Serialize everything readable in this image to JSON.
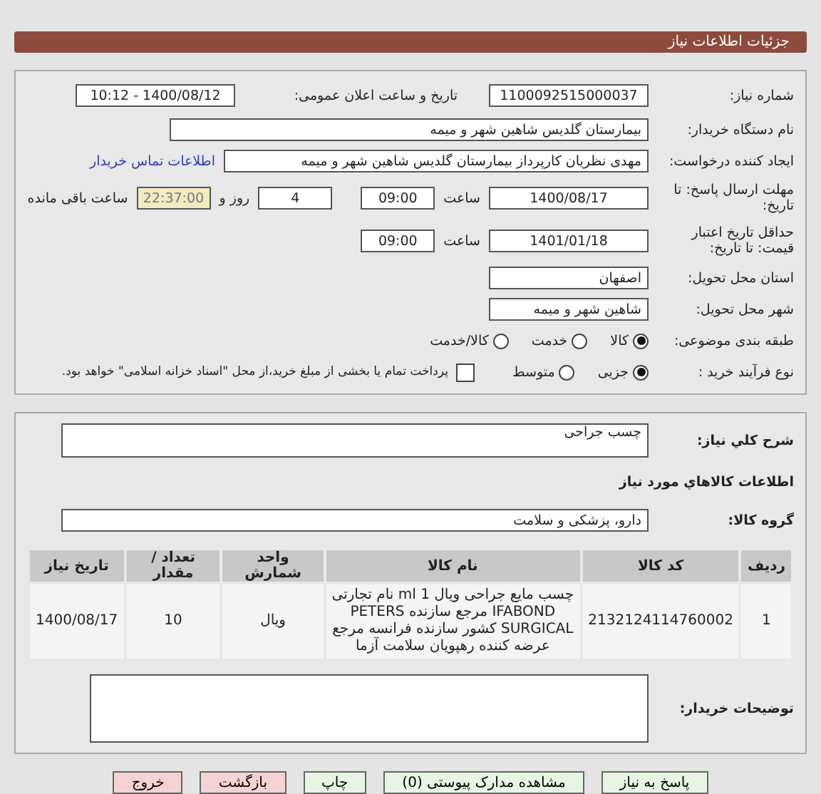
{
  "header": {
    "title": "جزئیات اطلاعات نیاز"
  },
  "details": {
    "need_number": {
      "label": "شماره نیاز:",
      "value": "1100092515000037"
    },
    "announce": {
      "label": "تاریخ و ساعت اعلان عمومی:",
      "value": "1400/08/12 - 10:12"
    },
    "buyer": {
      "label": "نام دستگاه خریدار:",
      "value": "بیمارستان گلدیس  شاهین شهر و میمه"
    },
    "creator": {
      "label": "ایجاد کننده درخواست:",
      "value": "مهدی نظریان کارپرداز بیمارستان گلدیس  شاهین شهر و میمه",
      "link": "اطلاعات تماس خریدار"
    },
    "deadline": {
      "label": "مهلت ارسال پاسخ: تا تاریخ:",
      "date": "1400/08/17",
      "time_label": "ساعت",
      "time": "09:00",
      "days": "4",
      "days_label": "روز و",
      "remaining": "22:37:00",
      "remaining_label": "ساعت باقی مانده"
    },
    "validity": {
      "label": "حداقل تاریخ اعتبار قیمت: تا تاریخ:",
      "date": "1401/01/18",
      "time_label": "ساعت",
      "time": "09:00"
    },
    "province": {
      "label": "استان محل تحویل:",
      "value": "اصفهان"
    },
    "city": {
      "label": "شهر محل تحویل:",
      "value": "شاهین شهر و میمه"
    },
    "category": {
      "label": "طبقه بندی موضوعی:",
      "options": [
        {
          "label": "کالا",
          "selected": true
        },
        {
          "label": "خدمت",
          "selected": false
        },
        {
          "label": "کالا/خدمت",
          "selected": false
        }
      ]
    },
    "process": {
      "label": "نوع فرآیند خرید :",
      "options": [
        {
          "label": "جزیی",
          "selected": true
        },
        {
          "label": "متوسط",
          "selected": false
        }
      ],
      "treasury": {
        "checked": false,
        "text": "پرداخت تمام یا بخشی از مبلغ خرید،از محل \"اسناد خزانه اسلامی\" خواهد بود."
      }
    }
  },
  "goods": {
    "summary": {
      "label": "شرح کلي نياز:",
      "value": "چسب جراحی"
    },
    "heading": "اطلاعات کالاهاي مورد نياز",
    "group": {
      "label": "گروه کالا:",
      "value": "دارو، پزشکی و سلامت"
    },
    "table": {
      "columns": [
        "ردیف",
        "کد کالا",
        "نام کالا",
        "واحد شمارش",
        "تعداد / مقدار",
        "تاریخ نیاز"
      ],
      "rows": [
        [
          "1",
          "2132124114760002",
          "چسب مایع جراحی ویال 1 ml نام تجارتی IFABOND مرجع سازنده PETERS SURGICAL کشور سازنده فرانسه مرجع عرضه کننده رهپویان سلامت آزما",
          "ویال",
          "10",
          "1400/08/17"
        ]
      ]
    },
    "notes": {
      "label": "توضیحات خریدار:"
    }
  },
  "buttons": [
    {
      "label": "پاسخ به نیاز",
      "color": "#e6f6e2"
    },
    {
      "label": "مشاهده مدارک پیوستی (0)",
      "color": "#e6f6e2"
    },
    {
      "label": "چاپ",
      "color": "#e6f6e2"
    },
    {
      "label": "بازگشت",
      "color": "#f6d3d3"
    },
    {
      "label": "خروج",
      "color": "#f6d3d3"
    }
  ]
}
